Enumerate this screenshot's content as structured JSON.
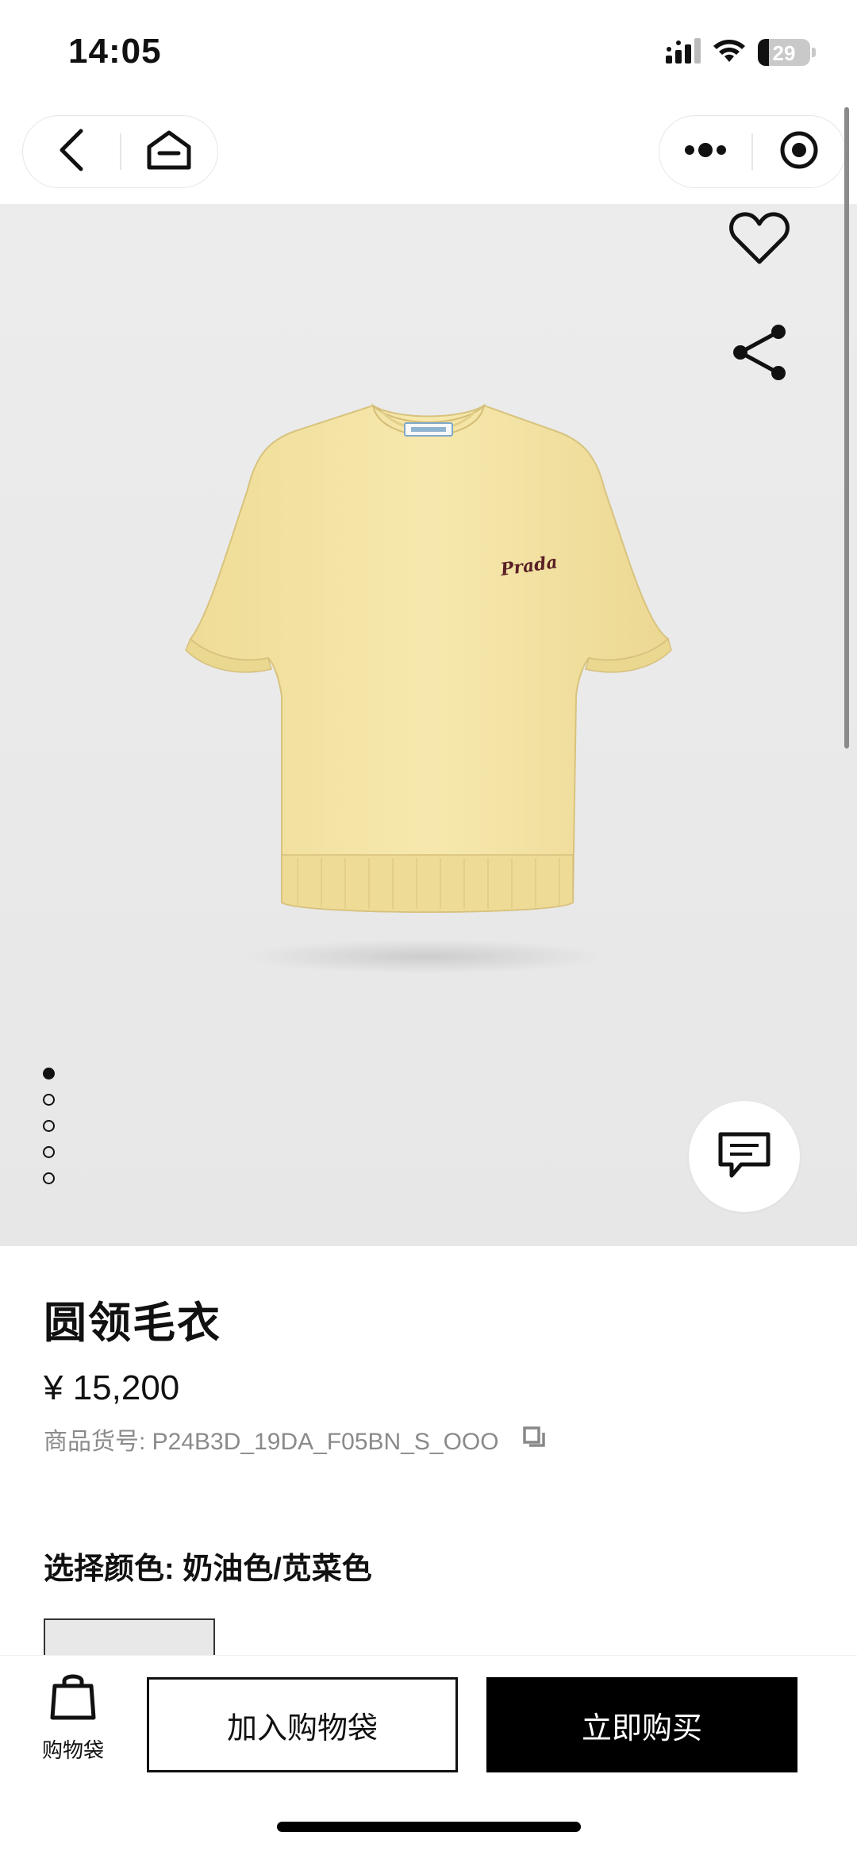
{
  "status_bar": {
    "time": "14:05",
    "battery_level": "29",
    "icons": [
      "cellular-signal-icon",
      "wifi-icon",
      "battery-icon"
    ]
  },
  "nav": {
    "icons": [
      "back-arrow-icon",
      "home-icon",
      "more-dots-icon",
      "close-target-icon"
    ]
  },
  "hero": {
    "image_description": "yellow short-sleeve knit crew-neck sweater with Prada logo",
    "logo_text": "Prada",
    "pager_count": 5,
    "pager_active_index": 0,
    "icons": [
      "heart-icon",
      "share-icon",
      "chat-icon"
    ]
  },
  "product": {
    "title": "圆领毛衣",
    "price": "¥ 15,200",
    "sku": "商品货号: P24B3D_19DA_F05BN_S_OOO",
    "color_label": "选择颜色: 奶油色/苋菜色"
  },
  "bottom_bar": {
    "bag_label": "购物袋",
    "add_to_bag_label": "加入购物袋",
    "buy_now_label": "立即购买"
  },
  "colors": {
    "accent": "#000000",
    "background": "#ffffff",
    "hero_background": "#e9e9ea",
    "sweater": "#f3e3a1",
    "muted_text": "#8a8a8a"
  }
}
